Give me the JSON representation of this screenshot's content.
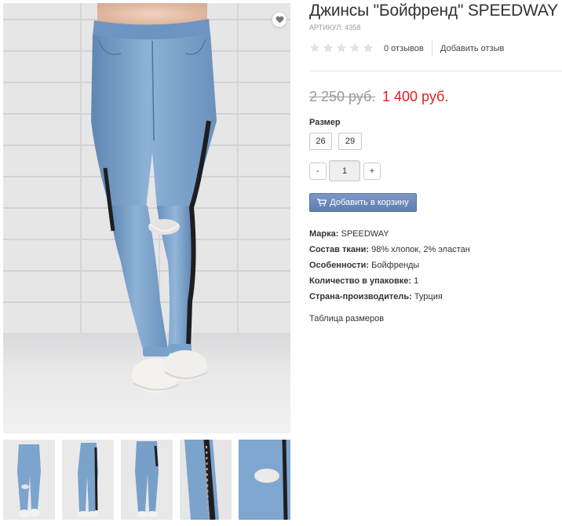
{
  "product": {
    "title": "Джинсы \"Бойфренд\" SPEEDWAY",
    "sku": "АРТИКУЛ: 4358",
    "rating": 0,
    "review_count": "0 отзывов",
    "add_review": "Добавить отзыв",
    "price_old": "2 250 руб.",
    "price_new": "1 400 руб."
  },
  "sizes": {
    "label": "Размер",
    "options": [
      "26",
      "29"
    ]
  },
  "quantity": {
    "minus": "-",
    "value": "1",
    "plus": "+"
  },
  "cart_button": {
    "label": "Добавить в корзину",
    "icon": "shopping-cart-icon"
  },
  "specs": [
    {
      "label": "Марка:",
      "value": "SPEEDWAY"
    },
    {
      "label": "Состав ткани:",
      "value": "98% хлопок, 2% эластан"
    },
    {
      "label": "Особенности:",
      "value": "Бойфренды"
    },
    {
      "label": "Количество в упаковке:",
      "value": "1"
    },
    {
      "label": "Страна-производитель:",
      "value": "Турция"
    }
  ],
  "size_table_link": "Таблица размеров",
  "gallery": {
    "wishlist_icon": "heart-icon",
    "thumbnails": 5
  },
  "colors": {
    "price_new": "#e02020",
    "price_old": "#999999",
    "button": "#6a88bb",
    "denim": "#7ea6cd"
  }
}
